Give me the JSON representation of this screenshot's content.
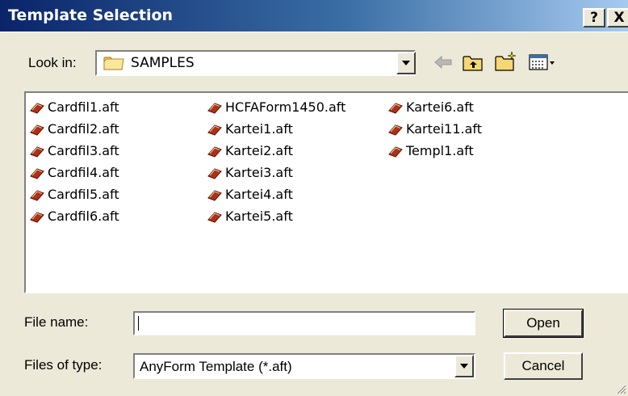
{
  "window": {
    "title": "Template Selection",
    "help_button": "?",
    "close_button": "X"
  },
  "lookin": {
    "label": "Look in:",
    "value": "SAMPLES"
  },
  "toolbar": {
    "icons": [
      "back-arrow-icon",
      "up-one-level-icon",
      "new-folder-icon",
      "view-menu-icon"
    ]
  },
  "files": {
    "column1": [
      "Cardfil1.aft",
      "Cardfil2.aft",
      "Cardfil3.aft",
      "Cardfil4.aft",
      "Cardfil5.aft",
      "Cardfil6.aft"
    ],
    "column2": [
      "HCFAForm1450.aft",
      "Kartei1.aft",
      "Kartei2.aft",
      "Kartei3.aft",
      "Kartei4.aft",
      "Kartei5.aft"
    ],
    "column3": [
      "Kartei6.aft",
      "Kartei11.aft",
      "Templ1.aft"
    ]
  },
  "filename": {
    "label": "File name:",
    "value": ""
  },
  "filetype": {
    "label": "Files of type:",
    "value": "AnyForm Template (*.aft)"
  },
  "buttons": {
    "open": "Open",
    "cancel": "Cancel"
  },
  "colors": {
    "title_start": "#0a246a",
    "title_end": "#a6caf0",
    "face": "#ece9d8",
    "file_icon": "#b03018"
  }
}
